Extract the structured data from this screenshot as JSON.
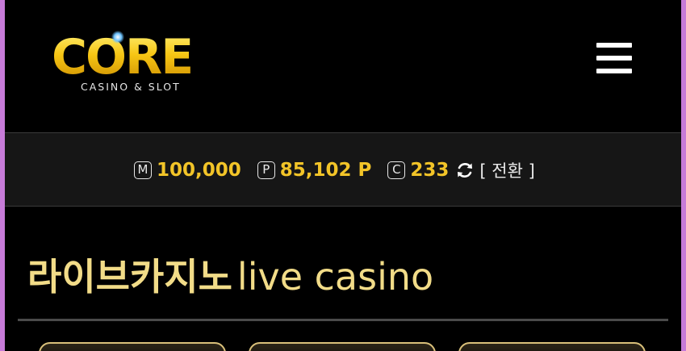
{
  "brand": {
    "logo_word": "CORE",
    "logo_sub": "CASINO & SLOT"
  },
  "points": {
    "money_icon": "Ⓜ",
    "money_value": "100,000",
    "point_icon": "Ⓟ",
    "point_value": "85,102 P",
    "coupon_icon": "Ⓒ",
    "coupon_value": "233",
    "switch_label": "[ 전환 ]"
  },
  "section": {
    "title_ko": "라이브카지노",
    "title_en": "live casino"
  },
  "colors": {
    "accent_gold": "#f2c428",
    "title_gold": "#f2dc88",
    "background": "#000000",
    "bar_background": "#161616"
  },
  "icons": [
    "menu-icon",
    "refresh-icon"
  ]
}
